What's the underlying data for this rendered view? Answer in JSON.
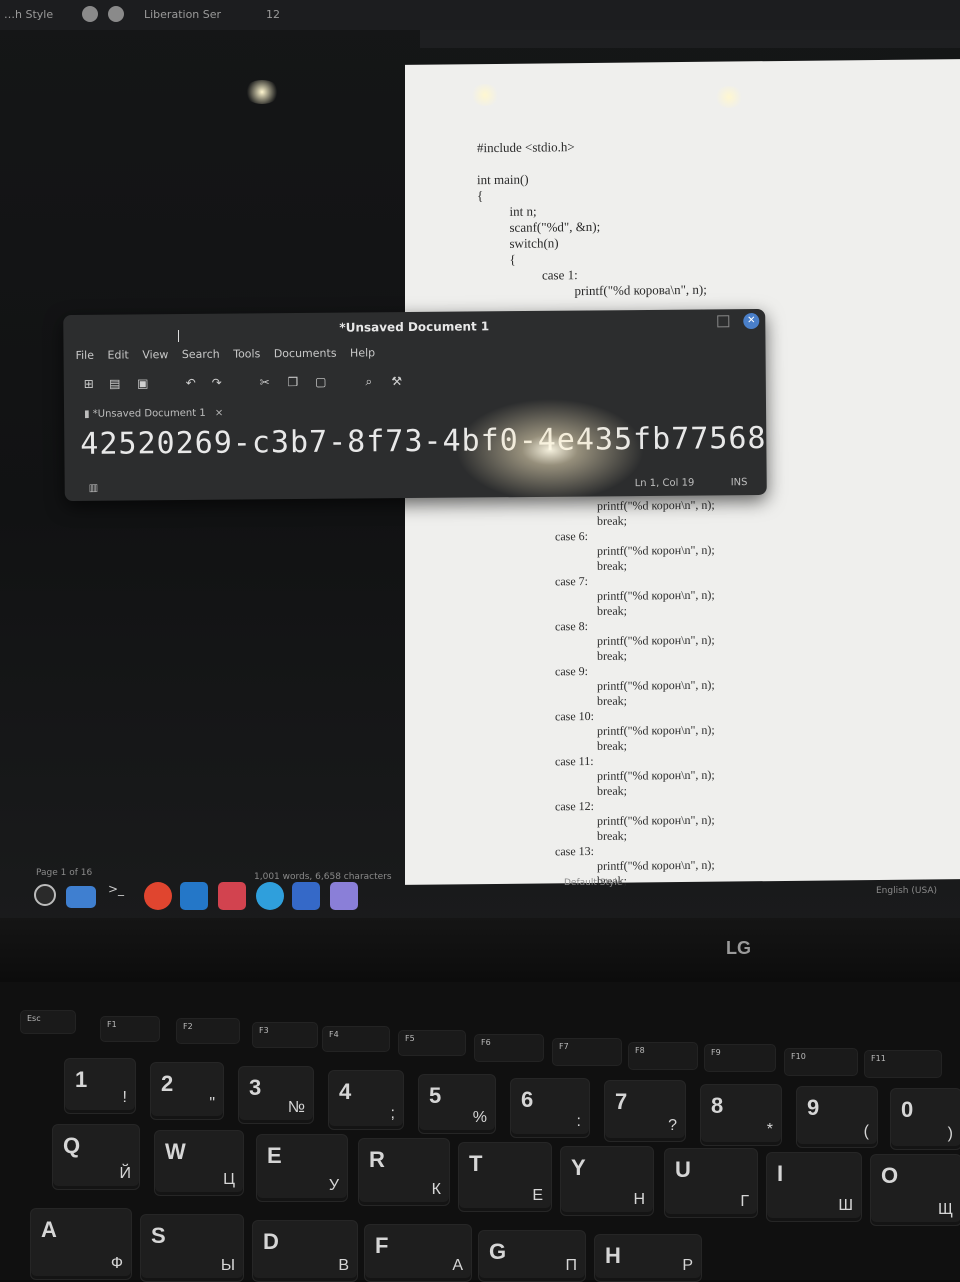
{
  "lo": {
    "style_label": "…h Style",
    "font_name": "Liberation Ser",
    "font_size": "12",
    "status_page": "Page 1 of 16",
    "status_words": "1,001 words, 6,658 characters",
    "status_style": "Default Style",
    "status_lang": "English (USA)"
  },
  "doc": {
    "code_top": "#include <stdio.h>\n\nint main()\n{\n          int n;\n          scanf(\"%d\", &n);\n          switch(n)\n          {\n                    case 1:\n                              printf(\"%d корова\\n\", n);",
    "code_bottom": "              printf(\"%d корон\\n\", n);\n              break;\ncase 6:\n              printf(\"%d корон\\n\", n);\n              break;\ncase 7:\n              printf(\"%d корон\\n\", n);\n              break;\ncase 8:\n              printf(\"%d корон\\n\", n);\n              break;\ncase 9:\n              printf(\"%d корон\\n\", n);\n              break;\ncase 10:\n              printf(\"%d корон\\n\", n);\n              break;\ncase 11:\n              printf(\"%d корон\\n\", n);\n              break;\ncase 12:\n              printf(\"%d корон\\n\", n);\n              break;\ncase 13:\n              printf(\"%d корон\\n\", n);\n              break;"
  },
  "editor": {
    "title": "*Unsaved Document 1",
    "menu": [
      "File",
      "Edit",
      "View",
      "Search",
      "Tools",
      "Documents",
      "Help"
    ],
    "tab_label": "*Unsaved Document 1",
    "text": "42520269-c3b7-8f73-4bf0-4e435fb77568",
    "position": "Ln 1, Col 19",
    "mode": "INS",
    "close_glyph": "✕",
    "tab_close_glyph": "×"
  },
  "laptop": {
    "brand": "LG"
  },
  "keyboard": {
    "fkeys": [
      "Esc",
      "F1",
      "F2",
      "F3",
      "F4",
      "F5",
      "F6",
      "F7",
      "F8",
      "F9",
      "F10",
      "F11"
    ],
    "row_num": [
      {
        "main": "1",
        "sub": "!"
      },
      {
        "main": "2",
        "sub": "\""
      },
      {
        "main": "3",
        "sub": "№"
      },
      {
        "main": "4",
        "sub": ";"
      },
      {
        "main": "5",
        "sub": "%"
      },
      {
        "main": "6",
        "sub": ":"
      },
      {
        "main": "7",
        "sub": "?"
      },
      {
        "main": "8",
        "sub": "*"
      },
      {
        "main": "9",
        "sub": "("
      },
      {
        "main": "0",
        "sub": ")"
      }
    ],
    "row_q": [
      {
        "main": "Q",
        "sub": "Й"
      },
      {
        "main": "W",
        "sub": "Ц"
      },
      {
        "main": "E",
        "sub": "У"
      },
      {
        "main": "R",
        "sub": "К"
      },
      {
        "main": "T",
        "sub": "Е"
      },
      {
        "main": "Y",
        "sub": "Н"
      },
      {
        "main": "U",
        "sub": "Г"
      },
      {
        "main": "I",
        "sub": "Ш"
      },
      {
        "main": "O",
        "sub": "Щ"
      }
    ],
    "row_a": [
      {
        "main": "A",
        "sub": "Ф"
      },
      {
        "main": "S",
        "sub": "Ы"
      },
      {
        "main": "D",
        "sub": "В"
      },
      {
        "main": "F",
        "sub": "А"
      },
      {
        "main": "G",
        "sub": "П"
      },
      {
        "main": "H",
        "sub": "Р"
      }
    ]
  }
}
